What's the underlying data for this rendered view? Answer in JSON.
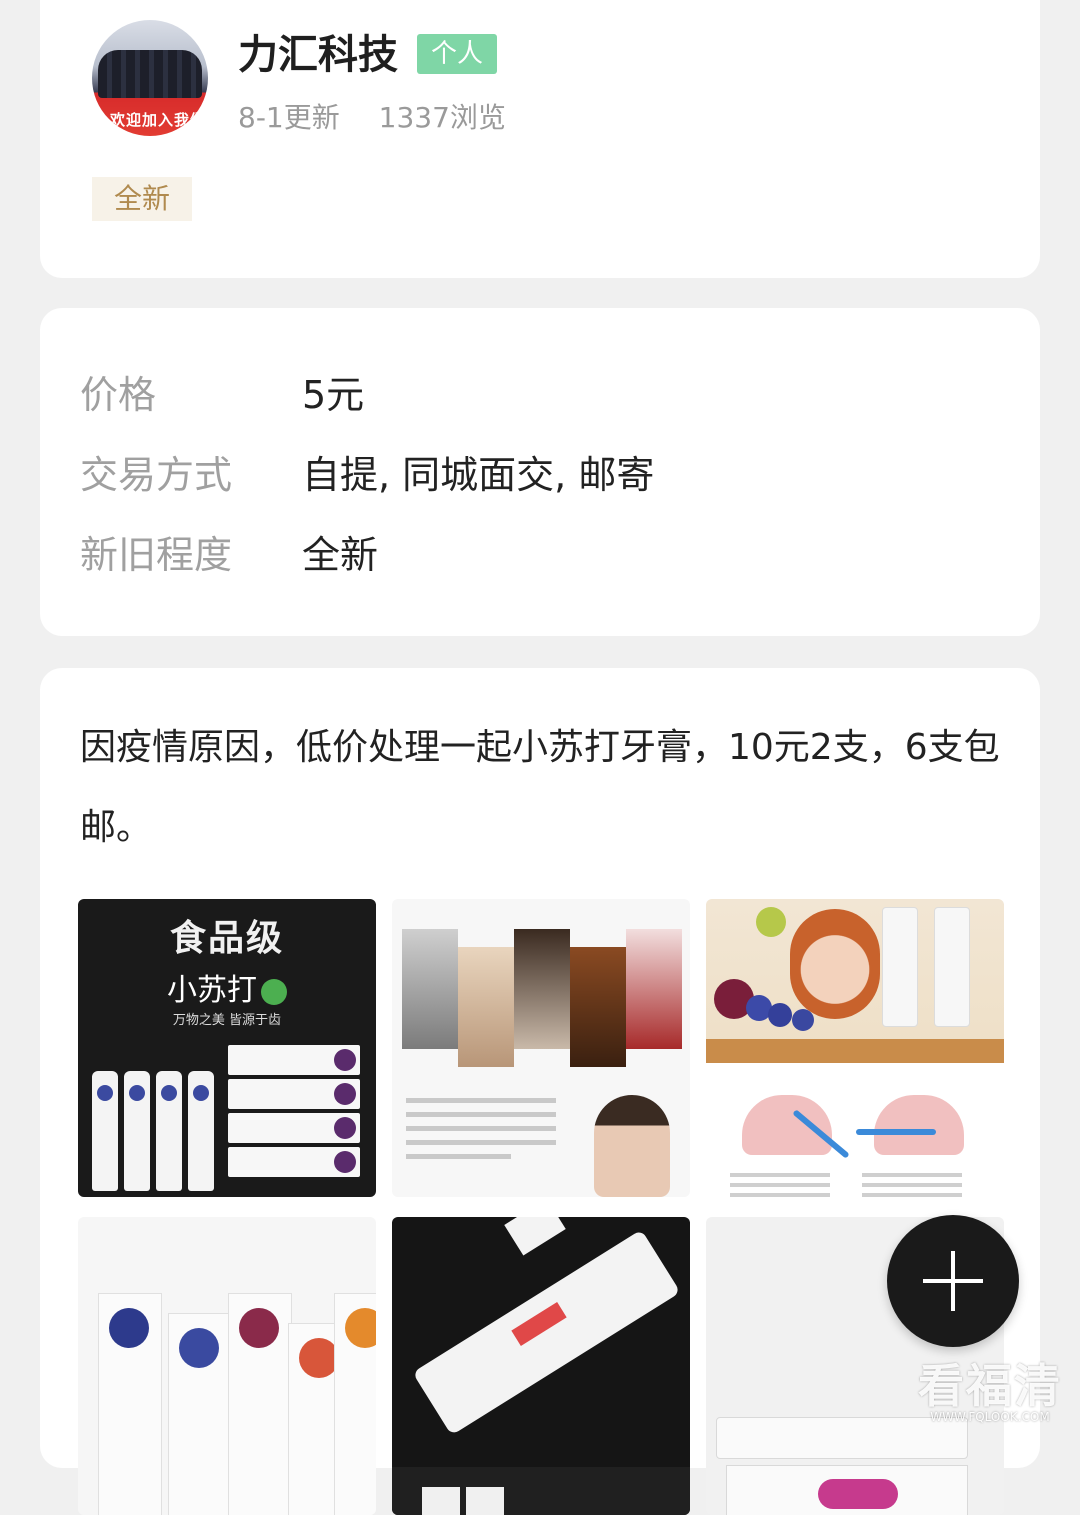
{
  "seller": {
    "name": "力汇科技",
    "badge": "个人",
    "updated": "8-1更新",
    "views": "1337浏览",
    "condition_tag": "全新",
    "avatar_banner_text": "欢迎加入我们"
  },
  "details": {
    "rows": [
      {
        "label": "价格",
        "value": "5元"
      },
      {
        "label": "交易方式",
        "value": "自提, 同城面交, 邮寄"
      },
      {
        "label": "新旧程度",
        "value": "全新"
      }
    ]
  },
  "description": {
    "text": "因疫情原因，低价处理一起小苏打牙膏，10元2支，6支包邮。"
  },
  "images": {
    "img1": {
      "title": "食品级",
      "brand": "小苏打",
      "slogan": "万物之美 皆源于齿"
    },
    "count": 6
  },
  "fab": {
    "icon": "plus-icon"
  },
  "watermark": {
    "text": "看福清",
    "url": "WWW.FQLOOK.COM"
  },
  "colors": {
    "badge_green": "#7fd6a6",
    "tag_bg": "#f7f2e8",
    "tag_text": "#b08a4e",
    "label_gray": "#a0a0a0",
    "fab_bg": "#1a1a1a"
  }
}
